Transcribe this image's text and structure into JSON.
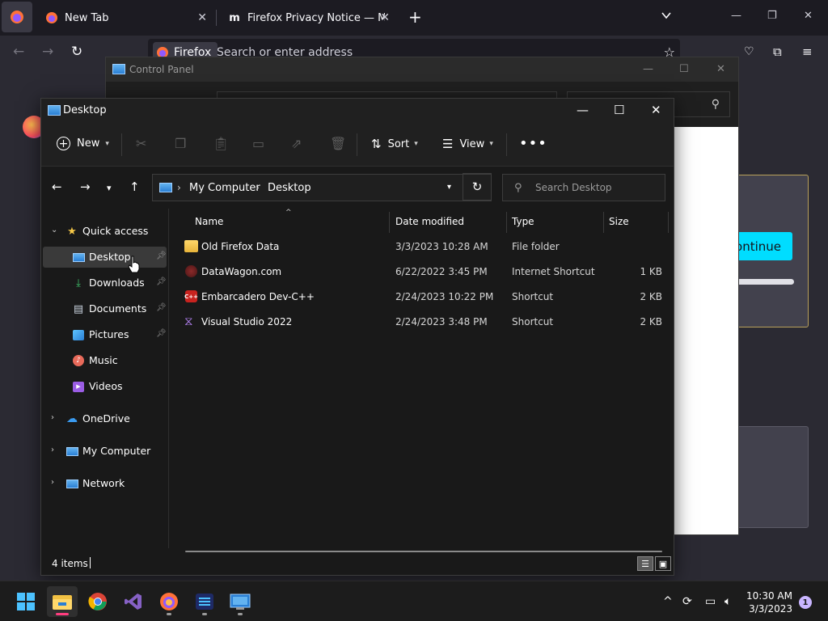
{
  "firefox": {
    "tabs": [
      {
        "title": "New Tab"
      },
      {
        "title": "Firefox Privacy Notice — Mozilla"
      }
    ],
    "new_tab_icon": "+",
    "urlbar": {
      "badge": "Firefox",
      "placeholder": "Search or enter address"
    },
    "background": {
      "continue_label": "Continue",
      "progress": 1.0
    }
  },
  "control_panel": {
    "title": "Control Panel"
  },
  "explorer": {
    "title": "Desktop",
    "commands": {
      "new": "New",
      "sort": "Sort",
      "view": "View"
    },
    "breadcrumb": [
      "My Computer",
      "Desktop"
    ],
    "search_placeholder": "Search Desktop",
    "sidebar": {
      "quick_access": "Quick access",
      "items": [
        {
          "label": "Desktop",
          "icon": "desktop-icon",
          "pinned": true,
          "selected": true
        },
        {
          "label": "Downloads",
          "icon": "downloads-icon",
          "pinned": true
        },
        {
          "label": "Documents",
          "icon": "documents-icon",
          "pinned": true
        },
        {
          "label": "Pictures",
          "icon": "pictures-icon",
          "pinned": true
        },
        {
          "label": "Music",
          "icon": "music-icon",
          "pinned": false
        },
        {
          "label": "Videos",
          "icon": "videos-icon",
          "pinned": false
        }
      ],
      "roots": [
        {
          "label": "OneDrive",
          "icon": "onedrive-icon"
        },
        {
          "label": "My Computer",
          "icon": "computer-icon"
        },
        {
          "label": "Network",
          "icon": "network-icon"
        }
      ]
    },
    "columns": {
      "name": "Name",
      "date": "Date modified",
      "type": "Type",
      "size": "Size"
    },
    "files": [
      {
        "name": "Old Firefox Data",
        "date": "3/3/2023 10:28 AM",
        "type": "File folder",
        "size": "",
        "icon": "folder-icon"
      },
      {
        "name": "DataWagon.com",
        "date": "6/22/2022 3:45 PM",
        "type": "Internet Shortcut",
        "size": "1 KB",
        "icon": "internet-shortcut-icon"
      },
      {
        "name": "Embarcadero Dev-C++",
        "date": "2/24/2023 10:22 PM",
        "type": "Shortcut",
        "size": "2 KB",
        "icon": "devcpp-icon"
      },
      {
        "name": "Visual Studio 2022",
        "date": "2/24/2023 3:48 PM",
        "type": "Shortcut",
        "size": "2 KB",
        "icon": "visual-studio-icon"
      }
    ],
    "status": "4 items"
  },
  "taskbar": {
    "time": "10:30 AM",
    "date": "3/3/2023",
    "notifications": "1",
    "apps": [
      "start",
      "file-explorer",
      "chrome",
      "visual-studio",
      "firefox",
      "dev-cpp",
      "control-panel"
    ]
  },
  "colors": {
    "accent": "#4cc2ff",
    "taskbar_active_indicator": "#ff3d7f",
    "firefox_cta": "#00ddff"
  }
}
